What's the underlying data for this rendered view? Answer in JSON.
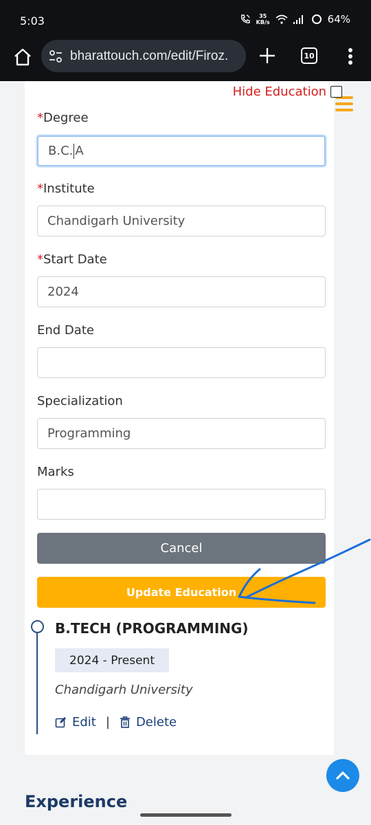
{
  "status_bar": {
    "time": "5:03",
    "net_speed_value": "35",
    "net_speed_unit": "KB/s",
    "battery": "64%",
    "icons": [
      "vowifi-call-icon",
      "wifi-icon",
      "signal-icon",
      "battery-icon"
    ]
  },
  "browser": {
    "url": "bharattouch.com/edit/Firoz.",
    "tab_count": "10",
    "icons": [
      "home-icon",
      "site-info-icon",
      "plus-icon",
      "tabs-icon",
      "more-vert-icon"
    ]
  },
  "form": {
    "hide_education_label": "Hide Education",
    "hide_education_checked": false,
    "required_marker": "*",
    "degree": {
      "label": "Degree",
      "before_caret": "B.C.",
      "after_caret": "A"
    },
    "institute": {
      "label": "Institute",
      "value": "Chandigarh University"
    },
    "start_date": {
      "label": "Start Date",
      "value": "2024"
    },
    "end_date": {
      "label": "End Date",
      "value": ""
    },
    "specialization": {
      "label": "Specialization",
      "value": "Programming"
    },
    "marks": {
      "label": "Marks",
      "value": ""
    },
    "cancel_label": "Cancel",
    "update_label": "Update Education"
  },
  "education_entry": {
    "title": "B.TECH (PROGRAMMING)",
    "dates": "2024 - Present",
    "institute": "Chandigarh University",
    "edit_label": "Edit",
    "separator": "|",
    "delete_label": "Delete"
  },
  "next_section_heading": "Experience",
  "colors": {
    "accent_orange": "#ffb000",
    "required_red": "#d21f1f",
    "link_blue": "#1b3f7a",
    "cancel_grey": "#6c747d",
    "annotation_blue": "#1b6fd6"
  }
}
